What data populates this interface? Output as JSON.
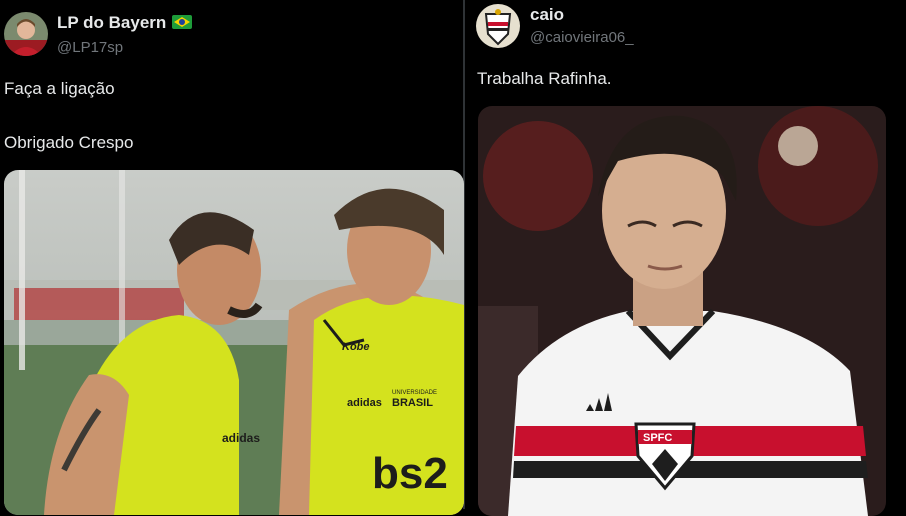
{
  "left_tweet": {
    "display_name": "LP do Bayern",
    "flag_icon": "brazil-flag-icon",
    "handle": "@LP17sp",
    "text_line1": "Faça a ligação",
    "text_line2": "Obrigado Crespo",
    "image": {
      "shirt_brand": "adidas",
      "badge_top": "UNIVERSIDADE",
      "badge_main": "BRASIL",
      "sponsor": "bs2",
      "chest_logo": "Kobe"
    }
  },
  "right_tweet": {
    "display_name": "caio",
    "handle": "@caiovieira06_",
    "text": "Trabalha Rafinha.",
    "image": {
      "crest_text": "SPFC"
    }
  },
  "colors": {
    "background": "#000000",
    "text": "#e7e9ea",
    "muted": "#71767b",
    "flamengo_yellow": "#d4e21e",
    "spfc_red": "#c8102e"
  }
}
